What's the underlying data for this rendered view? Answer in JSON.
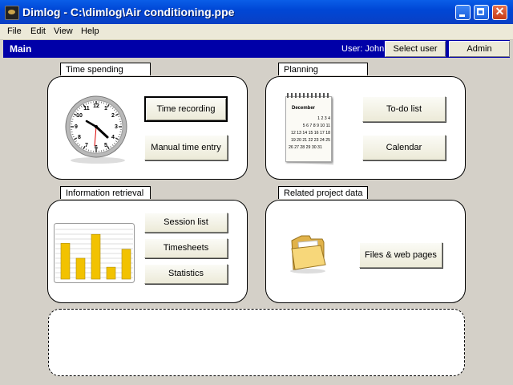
{
  "window": {
    "title": "Dimlog - C:\\dimlog\\Air conditioning.ppe",
    "close_glyph": "✕"
  },
  "menu": [
    "File",
    "Edit",
    "View",
    "Help"
  ],
  "header": {
    "title": "Main",
    "user": "User: John",
    "select_user": "Select user",
    "admin": "Admin"
  },
  "time_spending": {
    "tab": "Time spending",
    "time_recording": "Time recording",
    "manual_entry": "Manual time entry"
  },
  "planning": {
    "tab": "Planning",
    "todo": "To-do list",
    "calendar": "Calendar",
    "calendar_month": "December",
    "calendar_rows": [
      "1 2 3 4",
      "5 6 7 8 9 10 11",
      "12 13 14 15 16 17 18",
      "19 20 21 22 23 24 25",
      "26 27 28 29 30 31"
    ]
  },
  "information_retrieval": {
    "tab": "Information retrieval",
    "session_list": "Session list",
    "timesheets": "Timesheets",
    "statistics": "Statistics",
    "chart_bars": [
      0.72,
      0.42,
      0.9,
      0.24,
      0.6
    ]
  },
  "related_data": {
    "tab": "Related project data",
    "files_web": "Files & web pages"
  },
  "colors": {
    "header_bg": "#0000a8",
    "titlebar": "#0a4fd8",
    "bar_fill": "#f2c200"
  },
  "clock": {
    "hour_labels": [
      "12",
      "1",
      "2",
      "3",
      "4",
      "5",
      "6",
      "7",
      "8",
      "9",
      "10",
      "11"
    ]
  }
}
